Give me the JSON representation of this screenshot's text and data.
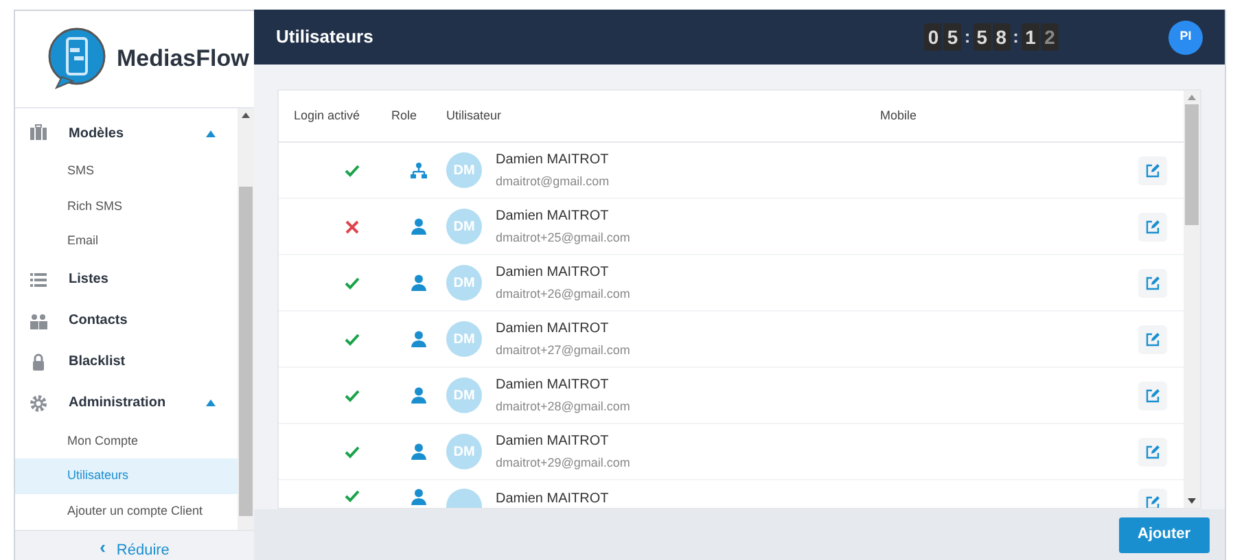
{
  "logo": {
    "name": "MediasFlow"
  },
  "sidebar": {
    "items": [
      {
        "label": "Modèles",
        "expanded": true,
        "children": [
          {
            "label": "SMS",
            "selected": false
          },
          {
            "label": "Rich SMS",
            "selected": false
          },
          {
            "label": "Email",
            "selected": false
          }
        ]
      },
      {
        "label": "Listes"
      },
      {
        "label": "Contacts"
      },
      {
        "label": "Blacklist"
      },
      {
        "label": "Administration",
        "expanded": true,
        "children": [
          {
            "label": "Mon Compte",
            "selected": false
          },
          {
            "label": "Utilisateurs",
            "selected": true
          },
          {
            "label": "Ajouter un compte Client",
            "selected": false
          }
        ]
      }
    ],
    "collapse": {
      "arrow": "‹",
      "label": "Réduire"
    }
  },
  "header": {
    "title": "Utilisateurs",
    "clock": [
      "0",
      "5",
      ":",
      "5",
      "8",
      ":",
      "1",
      "2"
    ],
    "avatar": "PI"
  },
  "table": {
    "columns": [
      "Login activé",
      "Role",
      "Utilisateur",
      "Mobile"
    ],
    "rows": [
      {
        "login_active": true,
        "kind": "admin",
        "initials": "DM",
        "name": "Damien MAITROT",
        "email": "dmaitrot@gmail.com"
      },
      {
        "login_active": false,
        "kind": "user",
        "initials": "DM",
        "name": "Damien MAITROT",
        "email": "dmaitrot+25@gmail.com"
      },
      {
        "login_active": true,
        "kind": "user",
        "initials": "DM",
        "name": "Damien MAITROT",
        "email": "dmaitrot+26@gmail.com"
      },
      {
        "login_active": true,
        "kind": "user",
        "initials": "DM",
        "name": "Damien MAITROT",
        "email": "dmaitrot+27@gmail.com"
      },
      {
        "login_active": true,
        "kind": "user",
        "initials": "DM",
        "name": "Damien MAITROT",
        "email": "dmaitrot+28@gmail.com"
      },
      {
        "login_active": true,
        "kind": "user",
        "initials": "DM",
        "name": "Damien MAITROT",
        "email": "dmaitrot+29@gmail.com"
      },
      {
        "login_active": true,
        "kind": "user",
        "name": "Damien MAITROT"
      }
    ]
  },
  "footer": {
    "button": "Ajouter"
  }
}
